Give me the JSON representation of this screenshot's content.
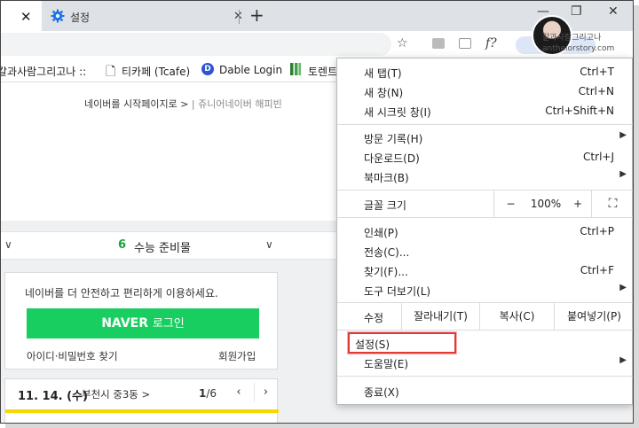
{
  "tabs": {
    "active_title": "설정"
  },
  "toolbar": {
    "ext_label": "f?"
  },
  "watermark": {
    "line1": "칼과사람그리고나",
    "line2": "antheiorstory.com"
  },
  "bookmarks": [
    {
      "label": "칼과사람그리고나 ::"
    },
    {
      "label": "티카페 (Tcafe)"
    },
    {
      "label": "Dable Login"
    },
    {
      "label": "토렌트"
    }
  ],
  "page": {
    "top_link": "네이버를 시작페이지로 >",
    "top_link2": "쥬니어네이버",
    "top_link3": "해피빈",
    "news_count": "6",
    "news_title": "수능 준비물",
    "login_msg": "네이버를 더 안전하고 편리하게 이용하세요.",
    "login_btn_brand": "NAVER",
    "login_btn_text": "로그인",
    "login_find": "아이디·비밀번호 찾기",
    "login_join": "회원가입",
    "weather_date": "11. 14. (수)",
    "weather_loc": "부천시 중3동 >",
    "weather_page_current": "1",
    "weather_page_total": "/6"
  },
  "menu": {
    "items_group1": [
      {
        "label": "새 탭(T)",
        "shortcut": "Ctrl+T"
      },
      {
        "label": "새 창(N)",
        "shortcut": "Ctrl+N"
      },
      {
        "label": "새 시크릿 창(I)",
        "shortcut": "Ctrl+Shift+N"
      }
    ],
    "items_group2": [
      {
        "label": "방문 기록(H)",
        "shortcut": ""
      },
      {
        "label": "다운로드(D)",
        "shortcut": "Ctrl+J"
      },
      {
        "label": "북마크(B)",
        "shortcut": ""
      }
    ],
    "zoom": {
      "label": "글꼴 크기",
      "minus": "−",
      "value": "100%",
      "plus": "+"
    },
    "items_group3": [
      {
        "label": "인쇄(P)",
        "shortcut": "Ctrl+P"
      },
      {
        "label": "전송(C)...",
        "shortcut": ""
      },
      {
        "label": "찾기(F)...",
        "shortcut": "Ctrl+F"
      },
      {
        "label": "도구 더보기(L)",
        "shortcut": ""
      }
    ],
    "edit": {
      "label": "수정",
      "cut": "잘라내기(T)",
      "copy": "복사(C)",
      "paste": "붙여넣기(P)"
    },
    "settings": "설정(S)",
    "help": "도움말(E)",
    "exit": "종료(X)"
  },
  "colors": {
    "naver_green": "#19ce60",
    "highlight_red": "#e53935",
    "news_green": "#1aa33b"
  }
}
